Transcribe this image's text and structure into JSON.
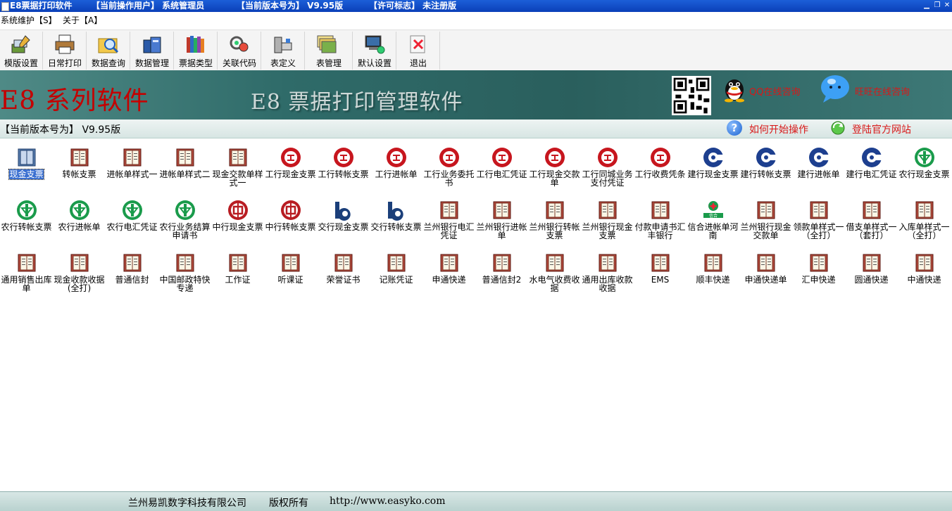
{
  "window": {
    "title": "E8票据打印软件",
    "user_label": "【当前操作用户】 系统管理员",
    "version_label": "【当前版本号为】 V9.95版",
    "license_label": "【许可标志】 未注册版"
  },
  "menu": [
    {
      "label": "系统维护【S】"
    },
    {
      "label": "关于【A】"
    }
  ],
  "toolbar": [
    {
      "label": "模版设置",
      "icon": "template-settings-icon"
    },
    {
      "label": "日常打印",
      "icon": "printer-icon"
    },
    {
      "label": "数据查询",
      "icon": "search-folder-icon"
    },
    {
      "label": "数据管理",
      "icon": "data-management-icon"
    },
    {
      "label": "票据类型",
      "icon": "books-icon"
    },
    {
      "label": "关联代码",
      "icon": "link-code-icon"
    },
    {
      "label": "表定义",
      "icon": "table-definition-icon"
    },
    {
      "label": "表管理",
      "icon": "table-management-icon"
    },
    {
      "label": "默认设置",
      "icon": "default-settings-icon"
    },
    {
      "label": "退出",
      "icon": "exit-icon"
    }
  ],
  "banner": {
    "logo_text": "E8 系列软件",
    "subtitle": "E8 票据打印管理软件",
    "qq_consult": "QQ在线咨询",
    "bubble_consult": "旺旺在线咨询"
  },
  "infobar": {
    "version": "【当前版本号为】 V9.95版",
    "howto": "如何开始操作",
    "official_site": "登陆官方网站"
  },
  "documents": [
    {
      "label": "现金支票",
      "icon": "selected-check"
    },
    {
      "label": "转帐支票",
      "icon": "book"
    },
    {
      "label": "进帐单样式一",
      "icon": "book"
    },
    {
      "label": "进帐单样式二",
      "icon": "book"
    },
    {
      "label": "现金交款单样式一",
      "icon": "book"
    },
    {
      "label": "工行现金支票",
      "icon": "icbc"
    },
    {
      "label": "工行转帐支票",
      "icon": "icbc"
    },
    {
      "label": "工行进帐单",
      "icon": "icbc"
    },
    {
      "label": "工行业务委托书",
      "icon": "icbc"
    },
    {
      "label": "工行电汇凭证",
      "icon": "icbc"
    },
    {
      "label": "工行现金交款单",
      "icon": "icbc"
    },
    {
      "label": "工行同城业务支付凭证",
      "icon": "icbc"
    },
    {
      "label": "工行收费凭条",
      "icon": "icbc"
    },
    {
      "label": "建行现金支票",
      "icon": "ccb"
    },
    {
      "label": "建行转帐支票",
      "icon": "ccb"
    },
    {
      "label": "建行进帐单",
      "icon": "ccb"
    },
    {
      "label": "建行电汇凭证",
      "icon": "ccb"
    },
    {
      "label": "农行现金支票",
      "icon": "abc"
    },
    {
      "label": "农行转帐支票",
      "icon": "abc"
    },
    {
      "label": "农行进帐单",
      "icon": "abc"
    },
    {
      "label": "农行电汇凭证",
      "icon": "abc"
    },
    {
      "label": "农行业务结算申请书",
      "icon": "abc"
    },
    {
      "label": "中行现金支票",
      "icon": "boc"
    },
    {
      "label": "中行转帐支票",
      "icon": "boc"
    },
    {
      "label": "交行现金支票",
      "icon": "bocom"
    },
    {
      "label": "交行转帐支票",
      "icon": "bocom"
    },
    {
      "label": "兰州银行电汇凭证",
      "icon": "book"
    },
    {
      "label": "兰州银行进帐单",
      "icon": "book"
    },
    {
      "label": "兰州银行转帐支票",
      "icon": "book"
    },
    {
      "label": "兰州银行现金支票",
      "icon": "book"
    },
    {
      "label": "付款申请书汇丰银行",
      "icon": "book"
    },
    {
      "label": "信合进帐单河南",
      "icon": "rcc"
    },
    {
      "label": "兰州银行现金交款单",
      "icon": "book"
    },
    {
      "label": "领款单样式一（全打）",
      "icon": "book"
    },
    {
      "label": "借支单样式一（套打）",
      "icon": "book"
    },
    {
      "label": "入库单样式一（全打）",
      "icon": "book"
    },
    {
      "label": "通用销售出库单",
      "icon": "book"
    },
    {
      "label": "现金收款收据(全打)",
      "icon": "book"
    },
    {
      "label": "普通信封",
      "icon": "book"
    },
    {
      "label": "中国邮政特快专递",
      "icon": "book"
    },
    {
      "label": "工作证",
      "icon": "book"
    },
    {
      "label": "听课证",
      "icon": "book"
    },
    {
      "label": "荣誉证书",
      "icon": "book"
    },
    {
      "label": "记账凭证",
      "icon": "book"
    },
    {
      "label": "申通快递",
      "icon": "book"
    },
    {
      "label": "普通信封2",
      "icon": "book"
    },
    {
      "label": "水电气收费收据",
      "icon": "book"
    },
    {
      "label": "通用出库收款收据",
      "icon": "book"
    },
    {
      "label": "EMS",
      "icon": "book"
    },
    {
      "label": "顺丰快递",
      "icon": "book"
    },
    {
      "label": "申通快递单",
      "icon": "book"
    },
    {
      "label": "汇申快递",
      "icon": "book"
    },
    {
      "label": "圆通快递",
      "icon": "book"
    },
    {
      "label": "中通快递",
      "icon": "book"
    }
  ],
  "footer": {
    "company": "兰州易凯数字科技有限公司",
    "rights": "版权所有",
    "url": "http://www.easyko.com"
  },
  "colors": {
    "titlebar": "#0a3fb8",
    "banner": "#2f6b69",
    "accent_red": "#d81818",
    "selection": "#3a6fd0"
  }
}
